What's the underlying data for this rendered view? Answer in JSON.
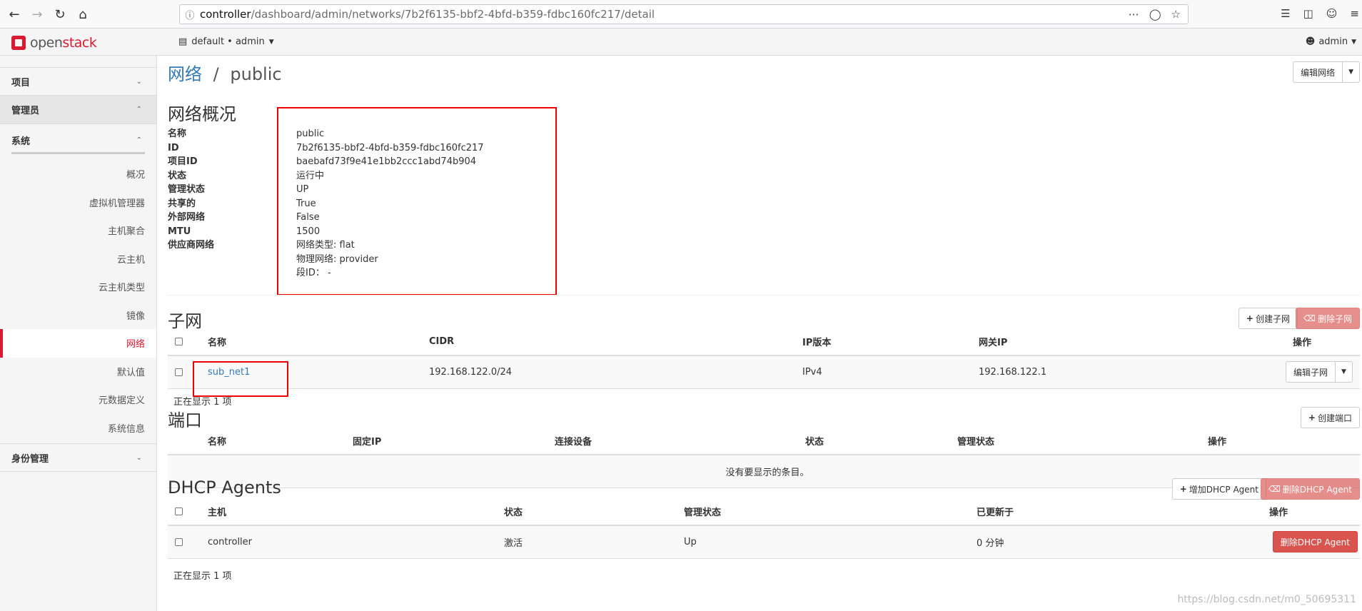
{
  "browser": {
    "url_host": "controller",
    "url_path": "/dashboard/admin/networks/7b2f6135-bbf2-4bfd-b359-fdbc160fc217/detail"
  },
  "topbar": {
    "logo_open": "open",
    "logo_stack": "stack",
    "project_selector": "default • admin",
    "user": "admin"
  },
  "sidebar": {
    "project": "项目",
    "admin": "管理员",
    "system": "系统",
    "links": [
      "概况",
      "虚拟机管理器",
      "主机聚合",
      "云主机",
      "云主机类型",
      "镜像",
      "网络",
      "默认值",
      "元数据定义",
      "系统信息"
    ],
    "identity": "身份管理"
  },
  "page": {
    "breadcrumb_parent": "网络",
    "breadcrumb_sep": "/",
    "breadcrumb_current": "public",
    "edit_network": "编辑网络"
  },
  "overview": {
    "title": "网络概况",
    "labels": [
      "名称",
      "ID",
      "项目ID",
      "状态",
      "管理状态",
      "共享的",
      "外部网络",
      "MTU",
      "供应商网络"
    ],
    "values": [
      "public",
      "7b2f6135-bbf2-4bfd-b359-fdbc160fc217",
      "baebafd73f9e41e1bb2ccc1abd74b904",
      "运行中",
      "UP",
      "True",
      "False",
      "1500",
      "网络类型: flat",
      "物理网络: provider",
      "段ID： -"
    ]
  },
  "subnets": {
    "title": "子网",
    "create_btn": "创建子网",
    "delete_btn": "删除子网",
    "headers": [
      "名称",
      "CIDR",
      "IP版本",
      "网关IP",
      "操作"
    ],
    "rows": [
      {
        "name": "sub_net1",
        "cidr": "192.168.122.0/24",
        "ip_version": "IPv4",
        "gateway": "192.168.122.1",
        "action": "编辑子网"
      }
    ],
    "count": "正在显示 1 项"
  },
  "ports": {
    "title": "端口",
    "create_btn": "创建端口",
    "headers": [
      "名称",
      "固定IP",
      "连接设备",
      "状态",
      "管理状态",
      "操作"
    ],
    "empty": "没有要显示的条目。"
  },
  "dhcp": {
    "title": "DHCP Agents",
    "add_btn": "增加DHCP Agent",
    "delete_btn": "删除DHCP Agent",
    "headers": [
      "主机",
      "状态",
      "管理状态",
      "已更新于",
      "操作"
    ],
    "rows": [
      {
        "host": "controller",
        "status": "激活",
        "admin_state": "Up",
        "updated": "0 分钟",
        "action": "删除DHCP Agent"
      }
    ],
    "count": "正在显示 1 项"
  },
  "watermark": "https://blog.csdn.net/m0_50695311"
}
